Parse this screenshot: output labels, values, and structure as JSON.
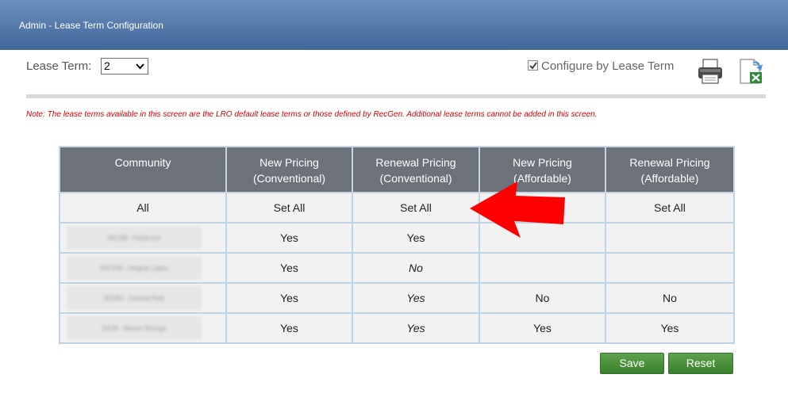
{
  "header": {
    "title": "Admin - Lease Term Configuration"
  },
  "lease_term": {
    "label": "Lease Term:",
    "selected": "2"
  },
  "configure": {
    "label": "Configure by Lease Term",
    "checked": true
  },
  "toolbar": {
    "print_icon": "printer-icon",
    "export_icon": "excel-export-icon"
  },
  "note": "Note: The lease terms available in this screen are the LRO default lease terms or those defined by RecGen. Additional lease terms cannot be added in this screen.",
  "table": {
    "headers": [
      [
        "Community"
      ],
      [
        "New Pricing",
        "(Conventional)"
      ],
      [
        "Renewal Pricing",
        "(Conventional)"
      ],
      [
        "New Pricing",
        "(Affordable)"
      ],
      [
        "Renewal Pricing",
        "(Affordable)"
      ]
    ],
    "all_row": {
      "label": "All",
      "set_all": "Set All"
    },
    "rows": [
      {
        "community": "00CAB - Fieldcrest",
        "cells": [
          "Yes",
          "Yes",
          "",
          ""
        ]
      },
      {
        "community": "00CT00 - Heights Lakes",
        "cells": [
          "Yes",
          "No",
          "",
          ""
        ]
      },
      {
        "community": "00CB0 - Central Park",
        "cells": [
          "Yes",
          "Yes",
          "No",
          "No"
        ]
      },
      {
        "community": "00CB - Mason Shuvge",
        "cells": [
          "Yes",
          "Yes",
          "Yes",
          "Yes"
        ]
      }
    ]
  },
  "buttons": {
    "save": "Save",
    "reset": "Reset"
  },
  "colors": {
    "yes": "#c6e7b9",
    "no": "#f99d9d",
    "header": "#6d717a",
    "accent": "#42679a",
    "arrow": "#ff0000"
  }
}
